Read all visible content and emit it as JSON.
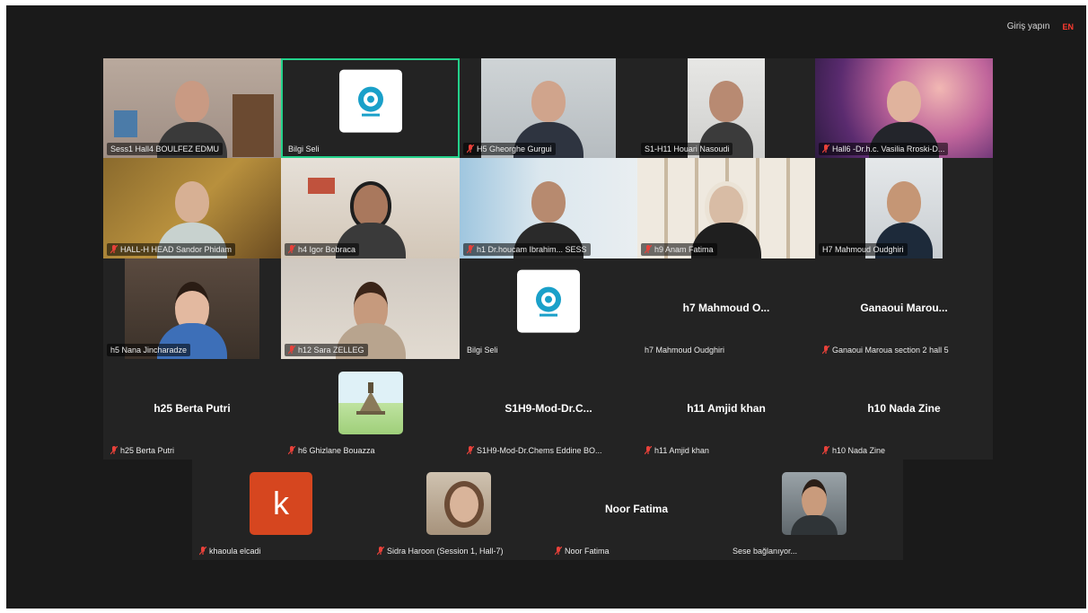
{
  "topbar": {
    "login": "Giriş yapın",
    "lang": "EN"
  },
  "colors": {
    "active_border": "#23d18b",
    "mute_icon": "#e8413a"
  },
  "tiles": [
    {
      "name": "Sess1 Hall4 BOULFEZ EDMU"
    },
    {
      "name": "Bilgi Seli"
    },
    {
      "name": "H5 Gheorghe Gurgui"
    },
    {
      "name": "S1-H11 Houari Nasoudi"
    },
    {
      "name": "Hall6 -Dr.h.c. Vasilia Rroski-D..."
    },
    {
      "name": "HALL-H HEAD Sandor Phidam"
    },
    {
      "name": "h4 Igor Bobraca"
    },
    {
      "name": "h1 Dr.houcam Ibrahim... SESS"
    },
    {
      "name": "h9 Anam Fatima"
    },
    {
      "name": "H7 Mahmoud Oudghiri"
    },
    {
      "name": "h5 Nana Jincharadze"
    },
    {
      "name": "h12 Sara ZELLEG"
    },
    {
      "name": "Bilgi Seli"
    },
    {
      "name": "h7 Mahmoud Oudghiri",
      "display": "h7  Mahmoud  O..."
    },
    {
      "name": "Ganaoui Maroua section 2 hall 5",
      "display": "Ganaoui  Marou..."
    },
    {
      "name": "h25 Berta Putri",
      "display": "h25  Berta Putri"
    },
    {
      "name": "h6 Ghizlane Bouazza"
    },
    {
      "name": "S1H9-Mod-Dr.Chems Eddine BO...",
      "display": "S1H9-Mod-Dr.C..."
    },
    {
      "name": "h11 Amjid khan",
      "display": "h11  Amjid khan"
    },
    {
      "name": "h10 Nada Zine",
      "display": "h10  Nada Zine"
    },
    {
      "name": "khaoula elcadi"
    },
    {
      "name": "Sidra Haroon (Session 1, Hall-7)"
    },
    {
      "name": "Noor Fatima",
      "display": "Noor Fatima"
    },
    {
      "name": "Sese bağlanıyor..."
    }
  ],
  "avatar_letter": "k"
}
